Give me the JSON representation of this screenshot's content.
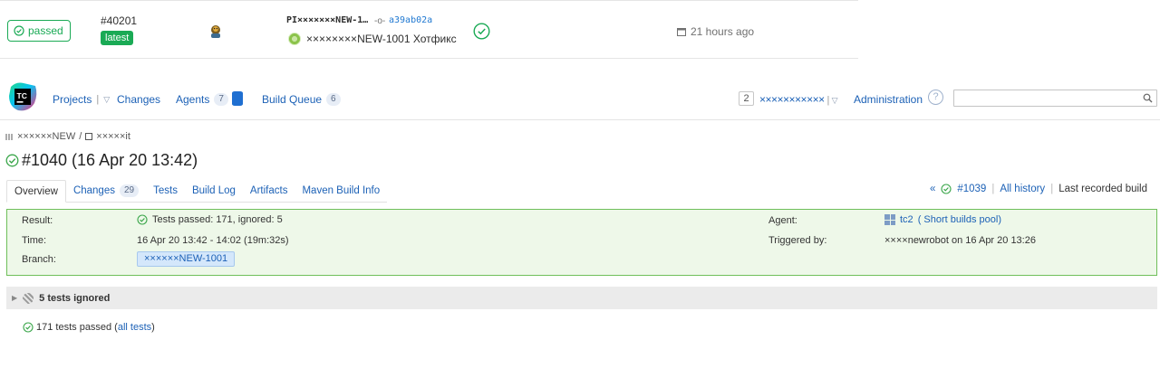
{
  "gitlab_pipeline": {
    "status_label": "passed",
    "pipeline_id": "#40201",
    "badge": "latest",
    "ref": "PΙ×××××××NEW-1…",
    "sha_icon": "commit-icon",
    "commit_sha": "a39ab02a",
    "commit_title": "××××××××NEW-1001 Хотфикс",
    "time_ago": "21 hours ago",
    "colors": {
      "success": "#1aaa55",
      "link": "#1f78d1"
    }
  },
  "teamcity_header": {
    "logo_text": "TC",
    "nav": {
      "projects": "Projects",
      "changes": "Changes",
      "agents": "Agents",
      "agents_count": "7",
      "build_queue": "Build Queue",
      "build_queue_count": "6"
    },
    "tray_counter": "2",
    "user_name": "×××××××××××",
    "administration": "Administration",
    "help": "?",
    "search_placeholder": ""
  },
  "breadcrumb": {
    "project": "××××××NEW",
    "separator": "/",
    "build_config": "×××××it"
  },
  "build": {
    "title": "#1040 (16 Apr 20 13:42)",
    "tabs": [
      {
        "label": "Overview",
        "active": true
      },
      {
        "label": "Changes",
        "count": "29"
      },
      {
        "label": "Tests"
      },
      {
        "label": "Build Log"
      },
      {
        "label": "Artifacts"
      },
      {
        "label": "Maven Build Info"
      }
    ],
    "history": {
      "prev_arrows": "«",
      "prev_build": "#1039",
      "all_history": "All history",
      "separator": "|",
      "last_recorded": "Last recorded build"
    }
  },
  "summary": {
    "result_label": "Result:",
    "result_value": "Tests passed: 171, ignored: 5",
    "time_label": "Time:",
    "time_value": "16 Apr 20 13:42 - 14:02 (19m:32s)",
    "branch_label": "Branch:",
    "branch_value": "××××××NEW-1001",
    "agent_label": "Agent:",
    "agent_name": "tc2",
    "agent_pool": "( Short builds pool)",
    "triggered_label": "Triggered by:",
    "triggered_value": "××××newrobot on 16 Apr 20 13:26",
    "colors": {
      "border": "#6fbf5a",
      "background": "#eef8e9"
    }
  },
  "tests": {
    "ignored_header": "5 tests ignored",
    "passed_text": "171 tests passed",
    "open_paren": "(",
    "all_tests_link": "all tests",
    "close_paren": ")"
  }
}
